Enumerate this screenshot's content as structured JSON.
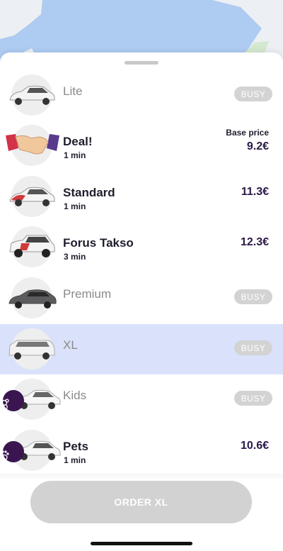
{
  "colors": {
    "accent": "#2b1848",
    "selected_bg": "#dae2fb",
    "busy_bg": "#d3d3d3",
    "map_water": "#aecbf2"
  },
  "options": [
    {
      "name": "Lite",
      "eta": "",
      "price": "",
      "base_label": "",
      "status": "BUSY",
      "icon": "white-sedan-icon"
    },
    {
      "name": "Deal!",
      "eta": "1 min",
      "price": "9.2€",
      "base_label": "Base price",
      "status": "",
      "icon": "handshake-icon"
    },
    {
      "name": "Standard",
      "eta": "1 min",
      "price": "11.3€",
      "base_label": "",
      "status": "",
      "icon": "red-white-sedan-icon"
    },
    {
      "name": "Forus Takso",
      "eta": "3 min",
      "price": "12.3€",
      "base_label": "",
      "status": "",
      "icon": "suv-icon"
    },
    {
      "name": "Premium",
      "eta": "",
      "price": "",
      "base_label": "",
      "status": "BUSY",
      "icon": "dark-sedan-icon"
    },
    {
      "name": "XL",
      "eta": "",
      "price": "",
      "base_label": "",
      "status": "BUSY",
      "icon": "minivan-icon"
    },
    {
      "name": "Kids",
      "eta": "",
      "price": "",
      "base_label": "",
      "status": "BUSY",
      "icon": "teddy-bear-icon"
    },
    {
      "name": "Pets",
      "eta": "1 min",
      "price": "10.6€",
      "base_label": "",
      "status": "",
      "icon": "paw-icon"
    }
  ],
  "order_button": {
    "label": "ORDER XL"
  }
}
